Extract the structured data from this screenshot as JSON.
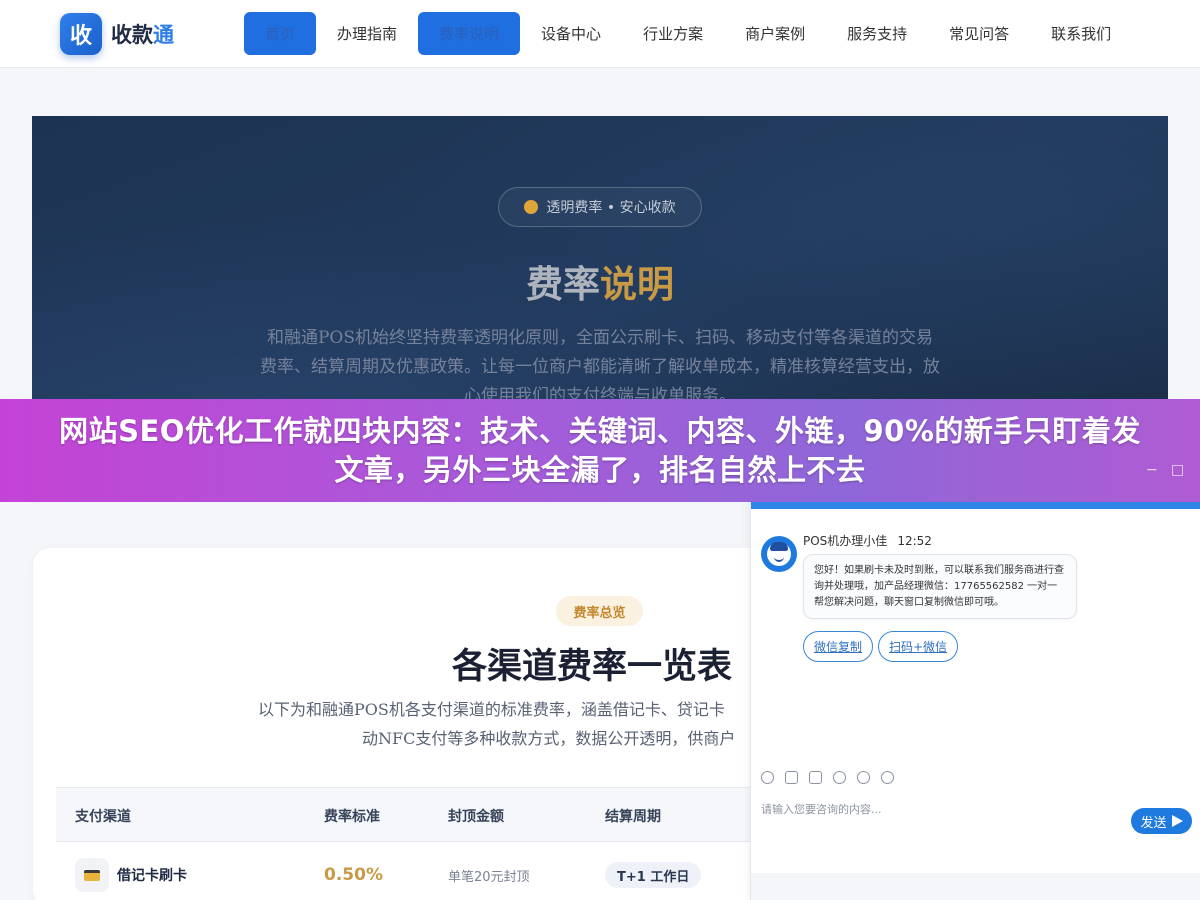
{
  "header": {
    "logo_mark": "收",
    "logo_main": "收款",
    "logo_accent": "通",
    "nav": [
      {
        "label": "首页",
        "active": true
      },
      {
        "label": "办理指南",
        "active": false
      },
      {
        "label": "费率说明",
        "active": true
      },
      {
        "label": "设备中心",
        "active": false
      },
      {
        "label": "行业方案",
        "active": false
      },
      {
        "label": "商户案例",
        "active": false
      },
      {
        "label": "服务支持",
        "active": false
      },
      {
        "label": "常见问答",
        "active": false
      },
      {
        "label": "联系我们",
        "active": false
      }
    ]
  },
  "hero": {
    "pill": "透明费率 • 安心收款",
    "title_main": "费率",
    "title_accent": "说明",
    "description": "和融通POS机始终坚持费率透明化原则，全面公示刷卡、扫码、移动支付等各渠道的交易费率、结算周期及优惠政策。让每一位商户都能清晰了解收单成本，精准核算经营支出，放心使用我们的支付终端与收单服务。"
  },
  "banner": {
    "text": "网站SEO优化工作就四块内容：技术、关键词、内容、外链，90%的新手只盯着发文章，另外三块全漏了，排名自然上不去",
    "minimize": "−",
    "maximize": "□"
  },
  "rates": {
    "pill": "费率总览",
    "title": "各渠道费率一览表",
    "desc_line1": "以下为和融通POS机各支付渠道的标准费率，涵盖借记卡、贷记卡",
    "desc_line2": "动NFC支付等多种收款方式，数据公开透明，供商户",
    "columns": [
      "支付渠道",
      "费率标准",
      "封顶金额",
      "结算周期"
    ],
    "rows": [
      {
        "channel": "借记卡刷卡",
        "rate": "0.50%",
        "cap": "单笔20元封顶",
        "settle": "T+1 工作日"
      }
    ]
  },
  "chat": {
    "agent_name": "POS机办理小佳",
    "time": "12:52",
    "message": "您好！如果刷卡未及时到账，可以联系我们服务商进行查询并处理哦，加产品经理微信：17765562582 一对一帮您解决问题，聊天窗口复制微信即可哦。",
    "quick_replies": [
      "微信复制",
      "扫码+微信"
    ],
    "input_placeholder": "请输入您要咨询的内容...",
    "send_label": "发送",
    "tool_icons": [
      "smile-icon",
      "image-icon",
      "crop-icon",
      "shield-icon",
      "mute-icon",
      "chat-history-icon"
    ]
  },
  "colors": {
    "brand_blue": "#1f6fe0",
    "gold": "#c99a45",
    "banner_purple": "#a85ad9"
  }
}
